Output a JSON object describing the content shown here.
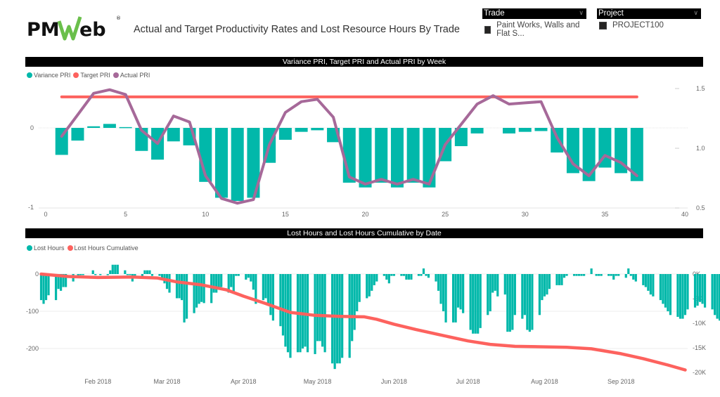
{
  "header": {
    "logo_text": "PMWeb",
    "logo_registered": "®",
    "title": "Actual and Target Productivity Rates and Lost Resource Hours By Trade"
  },
  "slicers": [
    {
      "label": "Trade",
      "selected": "Paint Works, Walls and Flat S..."
    },
    {
      "label": "Project",
      "selected": "PROJECT100"
    }
  ],
  "colors": {
    "teal": "#01B8AA",
    "red": "#FD625E",
    "purple": "#A66999",
    "header_bg": "#000000",
    "logo_green": "#6ABF4B"
  },
  "chart_data": [
    {
      "type": "bar+line",
      "title": "Variance PRI, Target PRI and Actual PRI by Week",
      "legend": [
        "Variance PRI",
        "Target PRI",
        "Actual PRI"
      ],
      "legend_position": "top-left",
      "xlabel": "",
      "ylabel": "",
      "x_ticks": [
        0,
        5,
        10,
        15,
        20,
        25,
        30,
        35,
        40
      ],
      "xlim": [
        0,
        40
      ],
      "y_left_ticks": [
        "0",
        "-1"
      ],
      "y_left_lim": [
        -1,
        0.85
      ],
      "y_right_ticks": [
        "1.5",
        "1.0",
        "0.5"
      ],
      "y_right_lim": [
        0.5,
        1.58
      ],
      "x": [
        1,
        2,
        3,
        4,
        5,
        6,
        7,
        8,
        9,
        10,
        11,
        12,
        13,
        14,
        15,
        16,
        17,
        18,
        19,
        20,
        21,
        22,
        23,
        24,
        25,
        26,
        27,
        28,
        29,
        30,
        31,
        32,
        33,
        34,
        35,
        36,
        37
      ],
      "series": [
        {
          "name": "Variance PRI",
          "type": "bar",
          "axis": "left",
          "values": [
            -0.34,
            -0.16,
            0.02,
            0.05,
            0.01,
            -0.29,
            -0.4,
            -0.17,
            -0.22,
            -0.68,
            -0.88,
            -0.92,
            -0.88,
            -0.44,
            -0.15,
            -0.05,
            -0.03,
            -0.18,
            -0.69,
            -0.75,
            -0.69,
            -0.75,
            -0.69,
            -0.75,
            -0.42,
            -0.23,
            -0.07,
            0,
            -0.07,
            -0.05,
            -0.04,
            -0.31,
            -0.57,
            -0.67,
            -0.5,
            -0.57,
            -0.67
          ]
        },
        {
          "name": "Target PRI",
          "type": "line",
          "axis": "right",
          "values": [
            1.43,
            1.43,
            1.43,
            1.43,
            1.43,
            1.43,
            1.43,
            1.43,
            1.43,
            1.43,
            1.43,
            1.43,
            1.43,
            1.43,
            1.43,
            1.43,
            1.43,
            1.43,
            1.43,
            1.43,
            1.43,
            1.43,
            1.43,
            1.43,
            1.43,
            1.43,
            1.43,
            1.43,
            1.43,
            1.43,
            1.43,
            1.43,
            1.43,
            1.43,
            1.43,
            1.43,
            1.43
          ]
        },
        {
          "name": "Actual PRI",
          "type": "line",
          "axis": "right",
          "values": [
            1.1,
            1.28,
            1.46,
            1.49,
            1.45,
            1.15,
            1.04,
            1.27,
            1.22,
            0.77,
            0.58,
            0.54,
            0.57,
            1.03,
            1.3,
            1.39,
            1.41,
            1.26,
            0.76,
            0.7,
            0.74,
            0.7,
            0.74,
            0.7,
            1.03,
            1.2,
            1.37,
            1.44,
            1.37,
            1.38,
            1.39,
            1.09,
            0.87,
            0.77,
            0.94,
            0.88,
            0.77
          ]
        }
      ]
    },
    {
      "type": "bar+line",
      "title": "Lost Hours and Lost Hours Cumulative by Date",
      "legend": [
        "Lost Hours",
        "Lost Hours Cumulative"
      ],
      "legend_position": "top-left",
      "xlabel": "",
      "ylabel": "",
      "x_ticks": [
        "Feb 2018",
        "Mar 2018",
        "Apr 2018",
        "May 2018",
        "Jun 2018",
        "Jul 2018",
        "Aug 2018",
        "Sep 2018"
      ],
      "x_tick_dates": [
        "2018-02-01",
        "2018-03-01",
        "2018-04-01",
        "2018-05-01",
        "2018-06-01",
        "2018-07-01",
        "2018-08-01",
        "2018-09-01"
      ],
      "xlim": [
        "2018-01-08",
        "2018-09-28"
      ],
      "y_left_ticks": [
        "0",
        "-100",
        "-200"
      ],
      "y_left_lim": [
        -300,
        35
      ],
      "y_right_ticks": [
        "0K",
        "-5K",
        "-10K",
        "-15K",
        "-20K"
      ],
      "y_right_lim": [
        -21000,
        0
      ],
      "series": [
        {
          "name": "Lost Hours",
          "type": "bar",
          "axis": "left",
          "start_date": "2018-01-09",
          "interval": "business-day",
          "values": [
            -70,
            -80,
            -70,
            -57,
            -70,
            -40,
            -45,
            -35,
            -35,
            -20,
            0,
            -5,
            -3,
            -2,
            0,
            10,
            -2,
            0,
            -2,
            -3,
            10,
            25,
            25,
            25,
            10,
            -2,
            -2,
            -20,
            -5,
            -5,
            10,
            10,
            10,
            -5,
            -5,
            -10,
            -25,
            -40,
            -50,
            -65,
            -65,
            -70,
            -130,
            -120,
            -105,
            -90,
            -80,
            -75,
            -78,
            -78,
            -50,
            -50,
            -40,
            -35,
            -50,
            -35,
            -50,
            -5,
            -5,
            -15,
            -10,
            -20,
            -42,
            -80,
            -70,
            -65,
            -85,
            -110,
            -125,
            -140,
            -165,
            -195,
            -210,
            -225,
            -210,
            -210,
            -200,
            -195,
            -210,
            -215,
            -180,
            -180,
            -195,
            -210,
            -240,
            -255,
            -240,
            -240,
            -225,
            -225,
            -180,
            -150,
            -100,
            -75,
            -65,
            -60,
            -45,
            -30,
            -20,
            -5,
            -15,
            -25,
            -5,
            -5,
            -5,
            -5,
            -15,
            -15,
            -15,
            -5,
            -5,
            15,
            -5,
            -10,
            -20,
            -45,
            -80,
            -100,
            -130,
            -130,
            -130,
            -90,
            -95,
            -105,
            -150,
            -160,
            -160,
            -160,
            -145,
            -110,
            -100,
            -50,
            -45,
            -60,
            -55,
            -155,
            -155,
            -150,
            -110,
            -120,
            -110,
            -150,
            -155,
            -150,
            -110,
            -70,
            -60,
            -55,
            -40,
            -30,
            -30,
            -30,
            -10,
            -5,
            -5,
            -5,
            -5,
            -5,
            -5,
            15,
            0,
            -5,
            -5,
            -5,
            -5,
            -5,
            -15,
            -5,
            -5,
            -10,
            15,
            -5,
            -15,
            -20,
            -30,
            -35,
            -45,
            -55,
            -60,
            -70,
            -80,
            -90,
            -100,
            -110,
            -115,
            -120,
            -120,
            -110,
            -95,
            -90,
            -85,
            -75,
            -80,
            -90,
            -95,
            -110,
            -120,
            -125,
            -120,
            -100,
            -130
          ]
        },
        {
          "name": "Lost Hours Cumulative",
          "type": "line",
          "axis": "right",
          "points": [
            [
              "2018-01-09",
              0
            ],
            [
              "2018-01-20",
              -500
            ],
            [
              "2018-02-01",
              -700
            ],
            [
              "2018-02-15",
              -600
            ],
            [
              "2018-02-25",
              -800
            ],
            [
              "2018-03-05",
              -1600
            ],
            [
              "2018-03-15",
              -2200
            ],
            [
              "2018-03-25",
              -3200
            ],
            [
              "2018-04-01",
              -4500
            ],
            [
              "2018-04-10",
              -6000
            ],
            [
              "2018-04-20",
              -7800
            ],
            [
              "2018-04-30",
              -8400
            ],
            [
              "2018-05-10",
              -8600
            ],
            [
              "2018-05-20",
              -8700
            ],
            [
              "2018-05-25",
              -9200
            ],
            [
              "2018-06-01",
              -10200
            ],
            [
              "2018-06-10",
              -11300
            ],
            [
              "2018-06-20",
              -12400
            ],
            [
              "2018-07-01",
              -13600
            ],
            [
              "2018-07-10",
              -14300
            ],
            [
              "2018-07-20",
              -14700
            ],
            [
              "2018-08-01",
              -14800
            ],
            [
              "2018-08-10",
              -14900
            ],
            [
              "2018-08-20",
              -15200
            ],
            [
              "2018-09-01",
              -16200
            ],
            [
              "2018-09-10",
              -17200
            ],
            [
              "2018-09-20",
              -18500
            ],
            [
              "2018-09-27",
              -19500
            ]
          ]
        }
      ]
    }
  ]
}
